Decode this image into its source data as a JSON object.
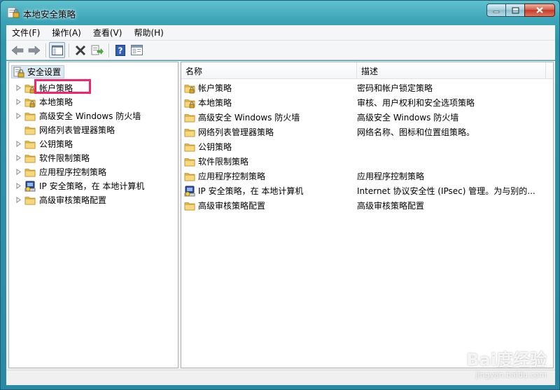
{
  "window": {
    "title": "本地安全策略"
  },
  "menubar": {
    "items": [
      "文件(F)",
      "操作(A)",
      "查看(V)",
      "帮助(H)"
    ]
  },
  "tree": {
    "root": "安全设置",
    "items": [
      {
        "label": "帐户策略",
        "icon": "folder-lock-icon",
        "expandable": true
      },
      {
        "label": "本地策略",
        "icon": "folder-lock-icon",
        "expandable": true
      },
      {
        "label": "高级安全 Windows 防火墙",
        "icon": "folder-icon",
        "expandable": true
      },
      {
        "label": "网络列表管理器策略",
        "icon": "folder-icon",
        "expandable": false
      },
      {
        "label": "公钥策略",
        "icon": "folder-icon",
        "expandable": true
      },
      {
        "label": "软件限制策略",
        "icon": "folder-icon",
        "expandable": true
      },
      {
        "label": "应用程序控制策略",
        "icon": "folder-icon",
        "expandable": true
      },
      {
        "label": "IP 安全策略，在 本地计算机",
        "icon": "ip-security-icon",
        "expandable": true
      },
      {
        "label": "高级审核策略配置",
        "icon": "folder-icon",
        "expandable": true
      }
    ]
  },
  "list": {
    "columns": [
      "名称",
      "描述"
    ],
    "rows": [
      {
        "name": "帐户策略",
        "desc": "密码和帐户锁定策略",
        "icon": "folder-lock-icon"
      },
      {
        "name": "本地策略",
        "desc": "审核、用户权利和安全选项策略",
        "icon": "folder-lock-icon"
      },
      {
        "name": "高级安全 Windows 防火墙",
        "desc": "高级安全 Windows 防火墙",
        "icon": "folder-icon"
      },
      {
        "name": "网络列表管理器策略",
        "desc": "网络名称、图标和位置组策略。",
        "icon": "folder-icon"
      },
      {
        "name": "公钥策略",
        "desc": "",
        "icon": "folder-icon"
      },
      {
        "name": "软件限制策略",
        "desc": "",
        "icon": "folder-icon"
      },
      {
        "name": "应用程序控制策略",
        "desc": "应用程序控制策略",
        "icon": "folder-icon"
      },
      {
        "name": "IP 安全策略，在 本地计算机",
        "desc": "Internet 协议安全性 (IPsec) 管理。为与别的...",
        "icon": "ip-security-icon"
      },
      {
        "name": "高级审核策略配置",
        "desc": "高级审核策略配置",
        "icon": "folder-icon"
      }
    ]
  },
  "watermark": {
    "brand": "Bai度经验",
    "url": "jingyan.baidu.com"
  },
  "colors": {
    "highlight": "#f5246b",
    "folder": "#f3cf6b",
    "title_glow": "#e8f8fb"
  }
}
